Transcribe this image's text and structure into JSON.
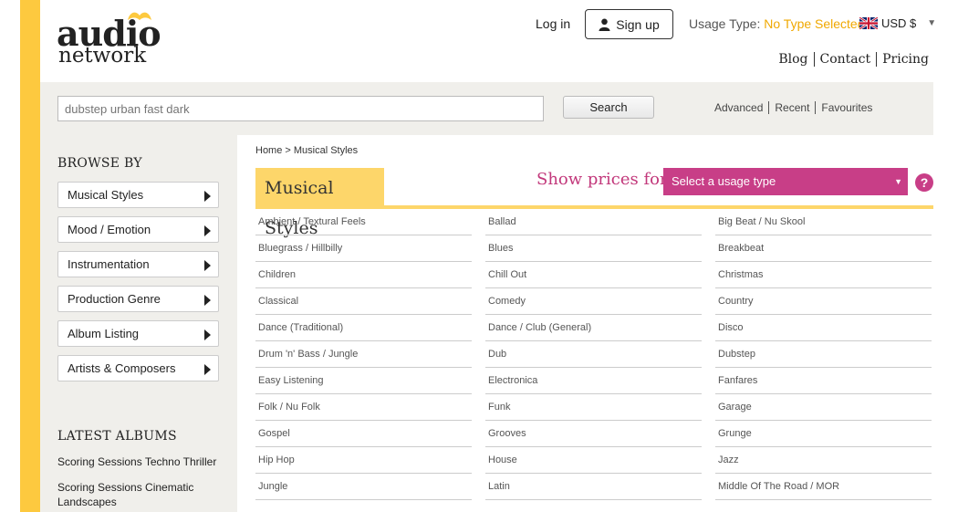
{
  "logo": {
    "line1": "audio",
    "line2": "network"
  },
  "header": {
    "login": "Log in",
    "signup": "Sign up",
    "usage_label": "Usage Type:",
    "usage_value": "No Type Selected",
    "currency": "USD $",
    "links": [
      "Blog",
      "Contact",
      "Pricing"
    ]
  },
  "search": {
    "placeholder": "dubstep urban fast dark",
    "button": "Search",
    "links": [
      "Advanced",
      "Recent",
      "Favourites"
    ]
  },
  "sidebar": {
    "browse_title": "BROWSE BY",
    "browse_items": [
      "Musical Styles",
      "Mood / Emotion",
      "Instrumentation",
      "Production Genre",
      "Album Listing",
      "Artists & Composers"
    ],
    "albums_title": "LATEST ALBUMS",
    "albums": [
      "Scoring Sessions Techno Thriller",
      "Scoring Sessions Cinematic Landscapes"
    ]
  },
  "content": {
    "breadcrumb": "Home > Musical Styles",
    "section_title": "Musical Styles",
    "show_prices": "Show prices for",
    "usage_select": "Select a usage type",
    "help": "?",
    "styles": [
      [
        "Ambient / Textural Feels",
        "Ballad",
        "Big Beat / Nu Skool"
      ],
      [
        "Bluegrass / Hillbilly",
        "Blues",
        "Breakbeat"
      ],
      [
        "Children",
        "Chill Out",
        "Christmas"
      ],
      [
        "Classical",
        "Comedy",
        "Country"
      ],
      [
        "Dance (Traditional)",
        "Dance / Club (General)",
        "Disco"
      ],
      [
        "Drum 'n' Bass / Jungle",
        "Dub",
        "Dubstep"
      ],
      [
        "Easy Listening",
        "Electronica",
        "Fanfares"
      ],
      [
        "Folk / Nu Folk",
        "Funk",
        "Garage"
      ],
      [
        "Gospel",
        "Grooves",
        "Grunge"
      ],
      [
        "Hip Hop",
        "House",
        "Jazz"
      ],
      [
        "Jungle",
        "Latin",
        "Middle Of The Road / MOR"
      ]
    ]
  },
  "colors": {
    "brand_yellow": "#fdc93f",
    "accent_pink": "#c83e87",
    "usage_value": "#f0a800"
  }
}
